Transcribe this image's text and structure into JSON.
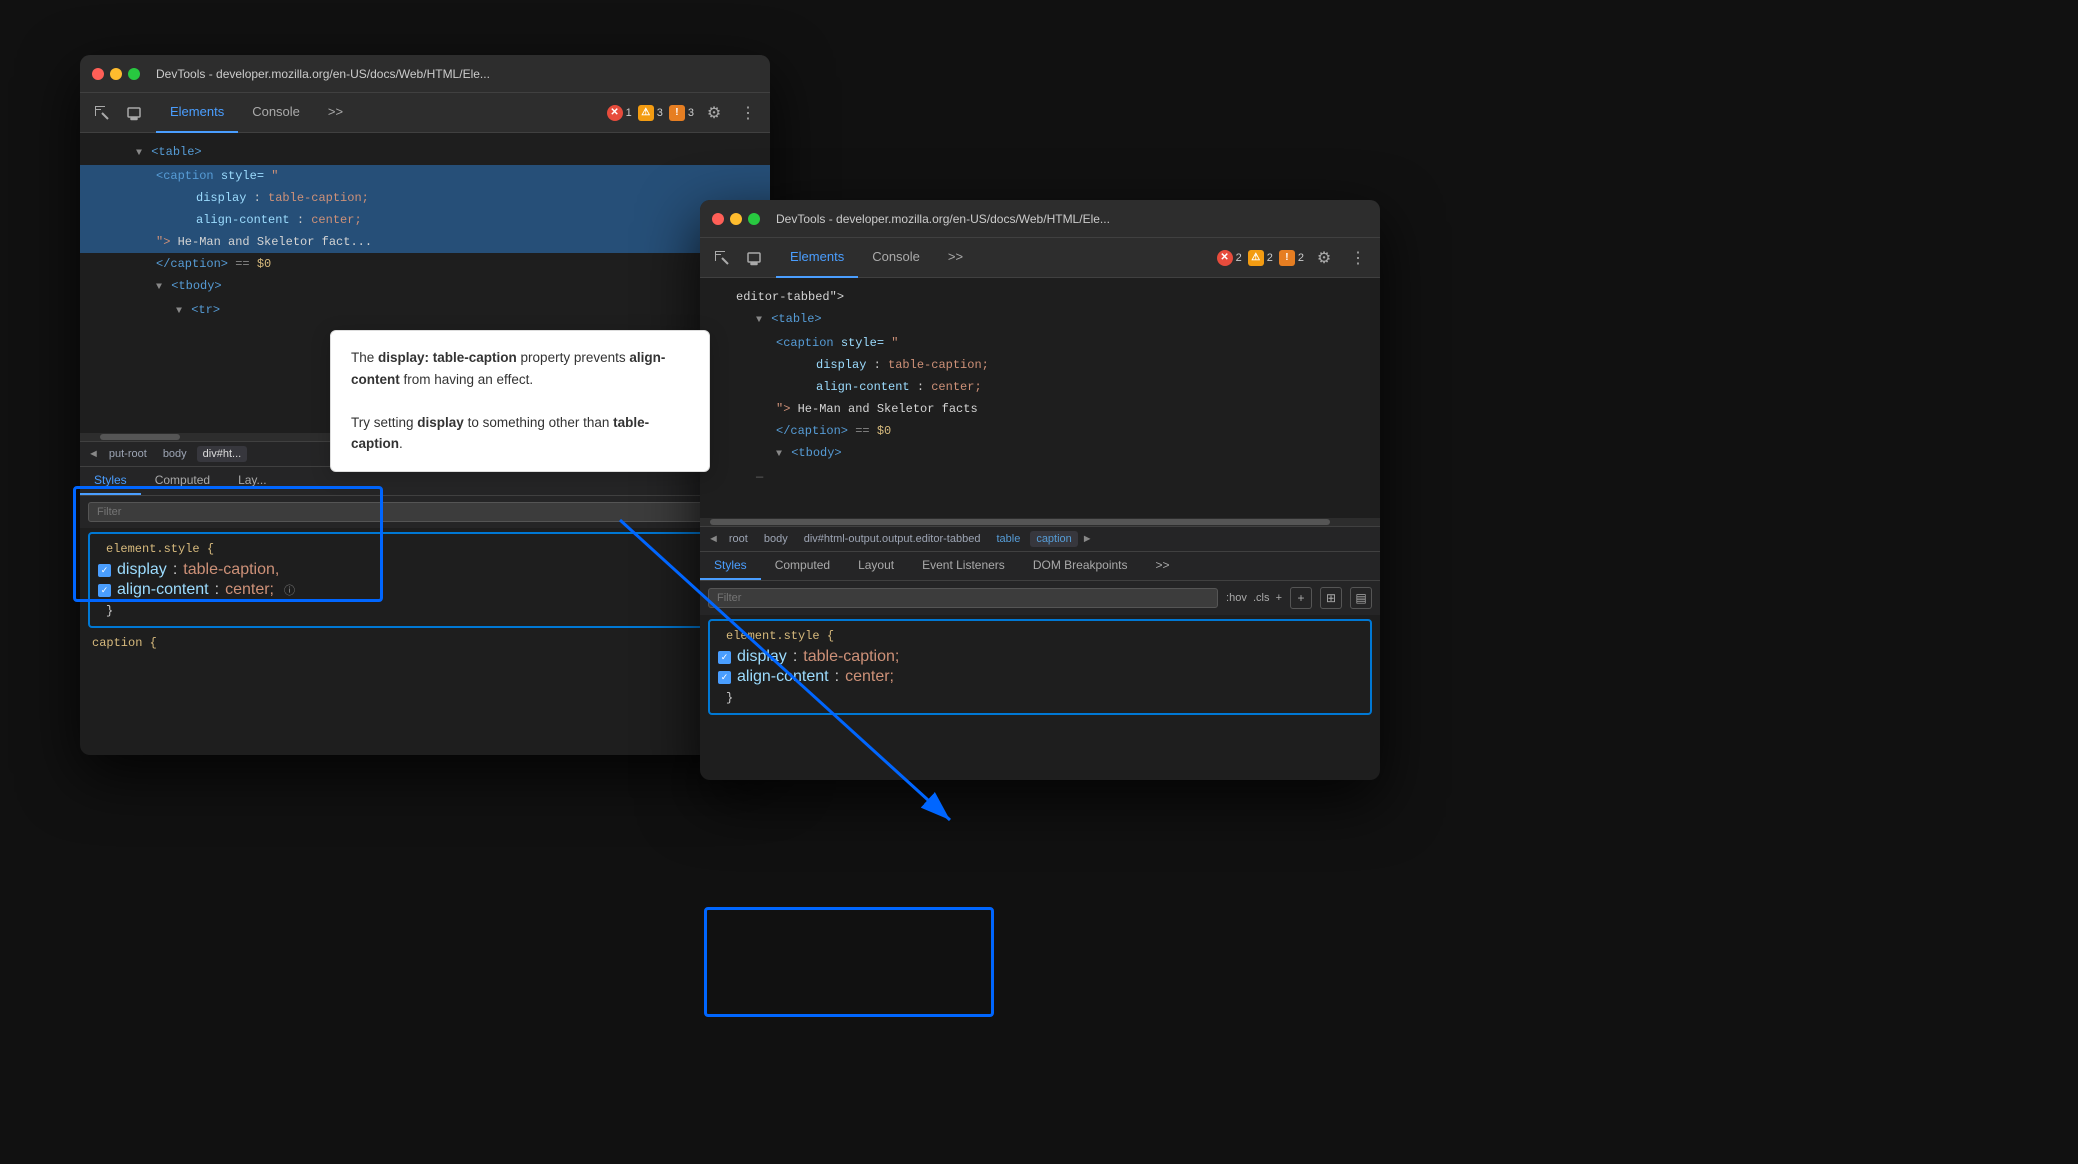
{
  "window1": {
    "title": "DevTools - developer.mozilla.org/en-US/docs/Web/HTML/Ele...",
    "tabs": {
      "elements": "Elements",
      "console": "Console",
      "more": ">>",
      "badge_error": "1",
      "badge_warning": "3",
      "badge_info": "3"
    },
    "html_lines": [
      {
        "indent": 3,
        "content": "▼<table>",
        "type": "tag"
      },
      {
        "indent": 5,
        "content": "<caption style=\"",
        "type": "tag",
        "selected": true
      },
      {
        "indent": 8,
        "content": "display: table-caption;",
        "type": "attr-value",
        "selected": true
      },
      {
        "indent": 8,
        "content": "align-content: center;",
        "type": "attr-value",
        "selected": true
      },
      {
        "indent": 5,
        "content": "\"> He-Man and Skeletor fact...",
        "type": "text",
        "selected": true
      },
      {
        "indent": 5,
        "content": "</caption> == $0",
        "type": "tag"
      },
      {
        "indent": 5,
        "content": "▼<tbody>",
        "type": "tag"
      },
      {
        "indent": 7,
        "content": "▼<tr>",
        "type": "tag"
      }
    ],
    "breadcrumb": [
      "◄",
      "put-root",
      "body",
      "div#ht..."
    ],
    "styles_tabs": [
      "Styles",
      "Computed",
      "Lay..."
    ],
    "filter_placeholder": "Filter",
    "css_rule": {
      "selector": "element.style {",
      "property1": "display",
      "value1": "table-caption,",
      "property2": "align-content",
      "value2": "center;",
      "close": "}"
    },
    "extra_line": "caption {"
  },
  "window2": {
    "title": "DevTools - developer.mozilla.org/en-US/docs/Web/HTML/Ele...",
    "tabs": {
      "elements": "Elements",
      "console": "Console",
      "more": ">>",
      "badge_error": "2",
      "badge_warning": "2",
      "badge_info": "2"
    },
    "html_lines": [
      {
        "indent": 2,
        "content": "editor-tabbed\">",
        "type": "text"
      },
      {
        "indent": 3,
        "content": "▼<table>",
        "type": "tag"
      },
      {
        "indent": 5,
        "content": "<caption style=\"",
        "type": "tag"
      },
      {
        "indent": 8,
        "content": "display: table-caption;",
        "type": "attr-value"
      },
      {
        "indent": 8,
        "content": "align-content: center;",
        "type": "attr-value"
      },
      {
        "indent": 5,
        "content": "\"> He-Man and Skeletor facts",
        "type": "text"
      },
      {
        "indent": 5,
        "content": "</caption> == $0",
        "type": "tag"
      },
      {
        "indent": 5,
        "content": "▼<tbody>",
        "type": "tag"
      },
      {
        "indent": 0,
        "content": "—",
        "type": "text"
      }
    ],
    "breadcrumb": [
      "◄",
      "root",
      "body",
      "div#html-output.output.editor-tabbed",
      "table",
      "caption",
      "►"
    ],
    "styles_tabs": [
      "Styles",
      "Computed",
      "Layout",
      "Event Listeners",
      "DOM Breakpoints",
      ">>"
    ],
    "filter_placeholder": "Filter",
    "filter_suffix": ":hov  .cls  +",
    "css_rule": {
      "selector": "element.style {",
      "property1": "display",
      "value1": "table-caption;",
      "property2": "align-content",
      "value2": "center;",
      "close": "}"
    }
  },
  "tooltip": {
    "line1_pre": "The ",
    "line1_bold": "display: table-caption",
    "line1_post": " property",
    "line2_pre": "prevents ",
    "line2_bold": "align-content",
    "line2_post": " from having an",
    "line3": "effect.",
    "line4_pre": "Try setting ",
    "line4_bold": "display",
    "line4_post": " to something other than",
    "line5_bold": "table-caption",
    "line5_post": "."
  },
  "icons": {
    "cursor": "⊹",
    "box": "⊡",
    "gear": "⚙",
    "more": "⋮",
    "inspect": "↖",
    "device": "▭",
    "checkbox_check": "✓"
  }
}
